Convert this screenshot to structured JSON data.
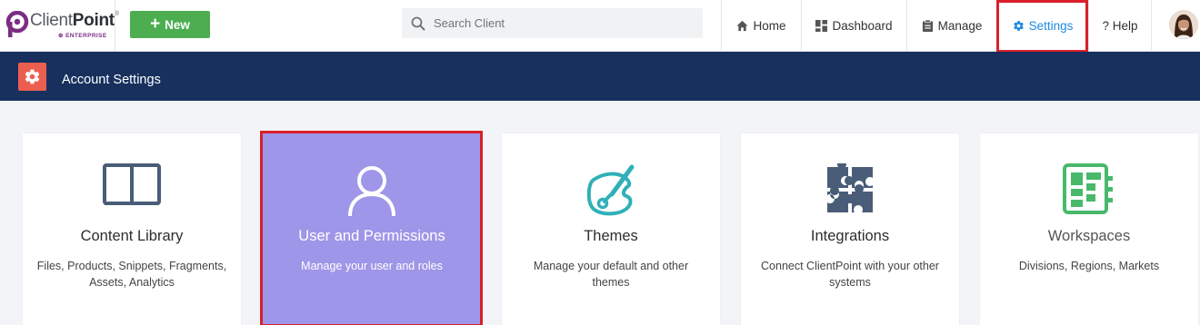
{
  "brand": {
    "name_light": "Client",
    "name_bold": "Point",
    "trademark": "®",
    "tier": "ENTERPRISE"
  },
  "toolbar": {
    "new_label": "New",
    "search_placeholder": "Search Client"
  },
  "nav": {
    "home": "Home",
    "dashboard": "Dashboard",
    "manage": "Manage",
    "settings": "Settings",
    "help": "? Help"
  },
  "header": {
    "title": "Account Settings"
  },
  "cards": [
    {
      "title": "Content Library",
      "desc": "Files, Products, Snippets, Fragments, Assets, Analytics",
      "icon": "book-icon"
    },
    {
      "title": "User and Permissions",
      "desc": "Manage your user and roles",
      "icon": "user-icon"
    },
    {
      "title": "Themes",
      "desc": "Manage your default and other themes",
      "icon": "paint-palette-icon"
    },
    {
      "title": "Integrations",
      "desc": "Connect ClientPoint with your other systems",
      "icon": "puzzle-icon"
    },
    {
      "title": "Workspaces",
      "desc": "Divisions, Regions, Markets",
      "icon": "workspaces-icon"
    }
  ],
  "colors": {
    "primary_nav": "#17305e",
    "new_button": "#4cae50",
    "active_nav": "#1e8ae0",
    "selected_card": "#9e96e8",
    "highlight": "#d9202a",
    "settings_tile": "#ec5e4f"
  }
}
